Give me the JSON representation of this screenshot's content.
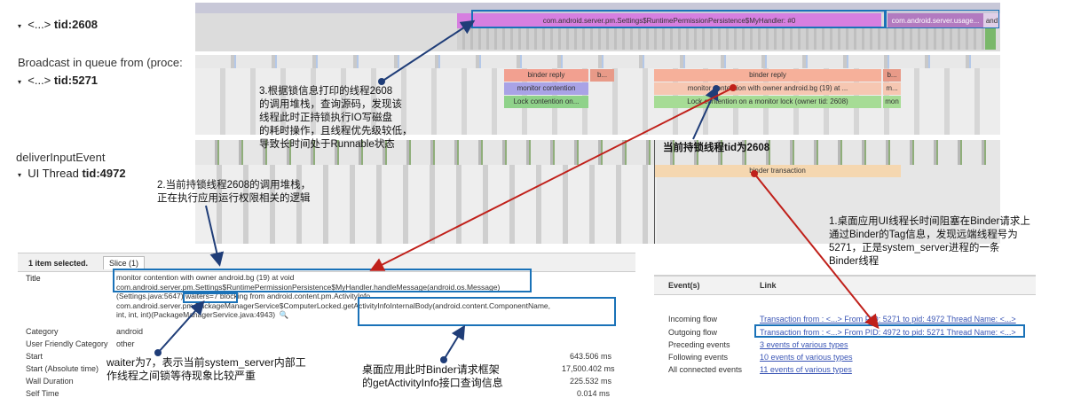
{
  "tracks": {
    "t1": {
      "prefix": "<...>",
      "tid": "tid:2608"
    },
    "t2_title": "Broadcast in queue from (proce:",
    "t2": {
      "prefix": "<...>",
      "tid": "tid:5271"
    },
    "t3_title": "deliverInputEvent",
    "t3": {
      "name": "UI Thread",
      "tid": "tid:4972"
    }
  },
  "slices": {
    "main_top": "com.android.server.pm.Settings$RuntimePermissionPersistence$MyHandler: #0",
    "usage": "com.android.server.usage...",
    "and": "and",
    "binder_reply_1": "binder reply",
    "b_1": "b...",
    "monitor_1": "monitor contention",
    "lock_1": "Lock contention on...",
    "binder_reply_2": "binder reply",
    "b_2": "b...",
    "monitor_2": "monitor contention with owner android.bg (19) at ...",
    "m_2": "m...",
    "lock_2": "Lock contention on a monitor lock (owner tid: 2608)",
    "mon": "mon",
    "binder_tx": "binder transaction"
  },
  "notes": {
    "n3": [
      "3.根据锁信息打印的线程2608",
      "的调用堆栈，查询源码，发现该",
      "线程此时正持锁执行IO写磁盘",
      "的耗时操作，且线程优先级较低，",
      "导致长时间处于Runnable状态"
    ],
    "holder": "当前持锁线程tid为2608",
    "n2": [
      "2.当前持锁线程2608的调用堆栈，",
      "正在执行应用运行权限相关的逻辑"
    ],
    "n1": [
      "1.桌面应用UI线程长时间阻塞在Binder请求上",
      "通过Binder的Tag信息，发现远端线程号为",
      "5271，正是system_server进程的一条",
      "Binder线程"
    ],
    "waiter": [
      "waiter为7，表示当前system_server内部工",
      "作线程之间锁等待现象比较严重"
    ],
    "binder_frame": [
      "桌面应用此时Binder请求框架",
      "的getActivityInfo接口查询信息"
    ]
  },
  "panel": {
    "selected": "1 item selected.",
    "tab": "Slice (1)",
    "title_label": "Title",
    "title_lines": [
      "monitor contention with owner android.bg (19) at void",
      "com.android.server.pm.Settings$RuntimePermissionPersistence$MyHandler.handleMessage(android.os.Message)",
      "(Settings.java:5647) waiters=7 blocking from android.content.pm.ActivityInfo",
      "com.android.server.pm.PackageManagerService$ComputerLocked.getActivityInfoInternalBody(android.content.ComponentName,",
      "int, int, int)(PackageManagerService.java:4943)"
    ],
    "fields": [
      {
        "label": "Category",
        "value": "android"
      },
      {
        "label": "User Friendly Category",
        "value": "other"
      },
      {
        "label": "Start",
        "value": "643.506 ms"
      },
      {
        "label": "Start (Absolute time)",
        "value": "17,500.402 ms"
      },
      {
        "label": "Wall Duration",
        "value": "225.532 ms"
      },
      {
        "label": "Self Time",
        "value": "0.014 ms"
      }
    ]
  },
  "events": {
    "header_event": "Event(s)",
    "header_link": "Link",
    "rows": [
      {
        "label": "Incoming flow",
        "link": "Transaction from : <...> From PID: 5271 to pid: 4972 Thread Name: <...>"
      },
      {
        "label": "Outgoing flow",
        "link": "Transaction from : <...> From PID: 4972 to pid: 5271 Thread Name: <...>"
      },
      {
        "label": "Preceding events",
        "link": "3 events of various types"
      },
      {
        "label": "Following events",
        "link": "10 events of various types"
      },
      {
        "label": "All connected events",
        "link": "11 events of various types"
      }
    ]
  }
}
